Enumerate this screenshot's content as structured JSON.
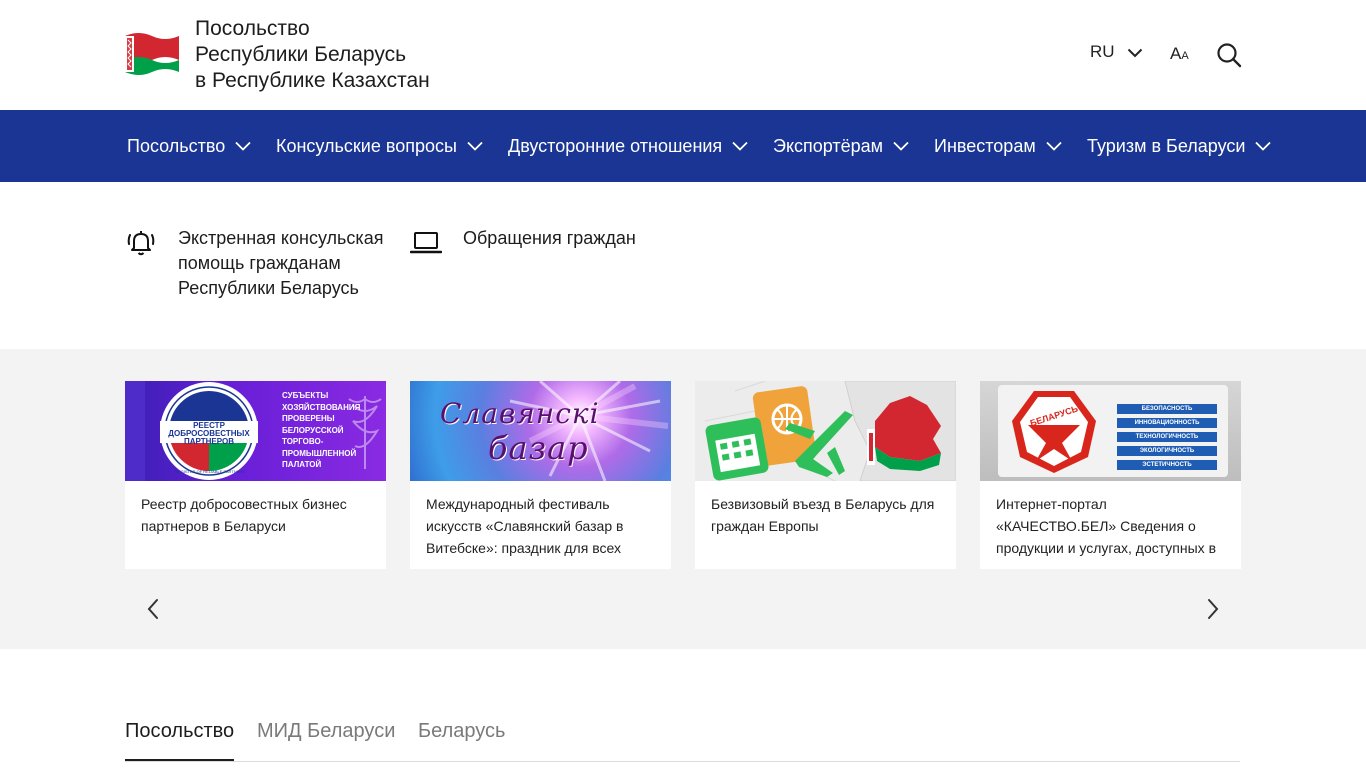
{
  "header": {
    "title_lines": [
      "Посольство",
      "Республики Беларусь",
      "в Республике Казахстан"
    ],
    "language": "RU",
    "fontsize_big": "A",
    "fontsize_small": "A",
    "flag_colors": {
      "red": "#d22730",
      "green": "#00a04a",
      "white": "#ffffff"
    }
  },
  "nav": {
    "background": "#1a3594",
    "items": [
      {
        "label": "Посольство"
      },
      {
        "label": "Консульские вопросы"
      },
      {
        "label": "Двусторонние отношения"
      },
      {
        "label": "Экспортёрам"
      },
      {
        "label": "Инвесторам"
      },
      {
        "label": "Туризм в Беларуси"
      }
    ]
  },
  "quick_links": [
    {
      "icon": "alarm-bell-icon",
      "lines": [
        "Экстренная консульская",
        "помощь гражданам",
        "Республики Беларусь"
      ]
    },
    {
      "icon": "laptop-icon",
      "lines": [
        "Обращения граждан"
      ]
    }
  ],
  "cards": [
    {
      "text": "Реестр добросовестных бизнес партнеров в Беларуси",
      "image": {
        "badge_lines": [
          "РЕЕСТР",
          "ДОБРОСОВЕСТНЫХ",
          "ПАРТНЕРОВ"
        ],
        "ring_text": "REGISTER OF RELIABLE PARTNERS",
        "side_lines": [
          "СУБЪЕКТЫ",
          "ХОЗЯЙСТВОВАНИЯ",
          "ПРОВЕРЕНЫ",
          "БЕЛОРУССКОЙ",
          "ТОРГОВО-",
          "ПРОМЫШЛЕННОЙ",
          "ПАЛАТОЙ"
        ]
      }
    },
    {
      "text": "Международный фестиваль искусств «Славянский базар в Витебске»: праздник для всех",
      "image": {
        "logo_line1": "Славянскі",
        "logo_line2": "базар"
      }
    },
    {
      "text": "Безвизовый въезд в Беларусь для граждан Европы",
      "image": {}
    },
    {
      "text": "Интернет-портал «КАЧЕСТВО.БЕЛ» Сведения о продукции и услугах, доступных в",
      "image": {
        "mark_text": "БЕЛАРУСЬ",
        "bars": [
          "БЕЗОПАСНОСТЬ",
          "ИННОВАЦИОННОСТЬ",
          "ТЕХНОЛОГИЧНОСТЬ",
          "ЭКОЛОГИЧНОСТЬ",
          "ЭСТЕТИЧНОСТЬ"
        ]
      }
    }
  ],
  "tabs": [
    {
      "label": "Посольство",
      "active": true
    },
    {
      "label": "МИД Беларуси",
      "active": false
    },
    {
      "label": "Беларусь",
      "active": false
    }
  ]
}
